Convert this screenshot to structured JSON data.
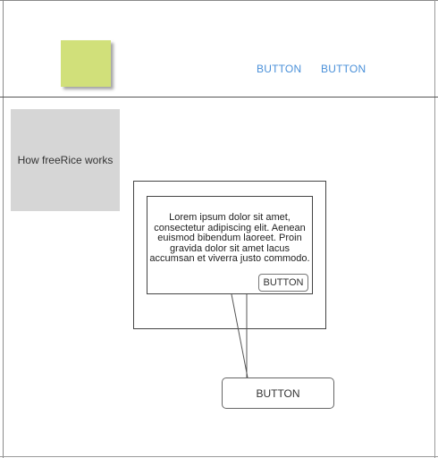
{
  "header": {
    "nav_buttons": [
      "BUTTON",
      "BUTTON"
    ]
  },
  "sidebar": {
    "info_box_label": "How freeRice works"
  },
  "content": {
    "card_text": "Lorem ipsum dolor sit amet, consectetur adipiscing elit. Aenean euismod bibendum laoreet. Proin gravida dolor sit amet lacus accumsan et viverra justo commodo.",
    "card_button_label": "BUTTON",
    "main_button_label": "BUTTON"
  },
  "colors": {
    "logo": "#d1e07a",
    "nav_link": "#4a90d9",
    "info_box": "#d6d6d6"
  }
}
